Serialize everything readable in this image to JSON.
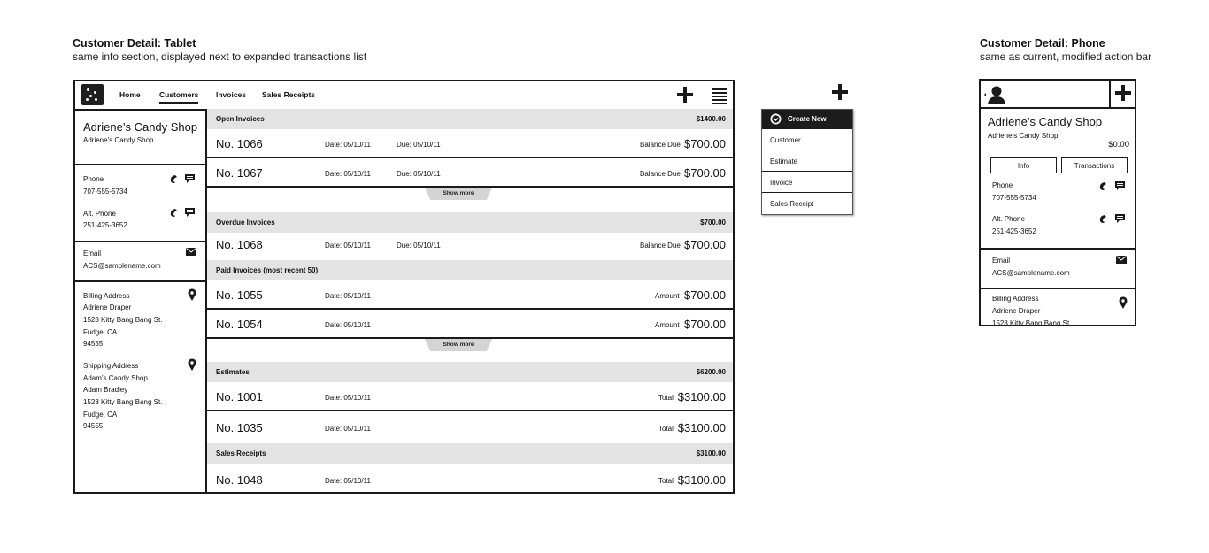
{
  "tablet_caption": {
    "title": "Customer Detail: Tablet",
    "subtitle": "same info section, displayed next to expanded transactions list"
  },
  "phone_caption": {
    "title": "Customer Detail: Phone",
    "subtitle": "same as current, modified action bar"
  },
  "nav": {
    "tabs": [
      "Home",
      "Customers",
      "Invoices",
      "Sales Receipts"
    ],
    "active": "Customers"
  },
  "customer": {
    "name": "Adriene’s Candy Shop",
    "company": "Adriene’s Candy Shop",
    "phone_label": "Phone",
    "phone": "707-555-5734",
    "alt_phone_label": "Alt. Phone",
    "alt_phone": "251-425-3652",
    "email_label": "Email",
    "email": "ACS@samplename.com",
    "billing_label": "Billing Address",
    "billing_lines": [
      "Adriene Draper",
      "1528 Kitty Bang Bang St.",
      "Fudge, CA",
      "94555"
    ],
    "shipping_label": "Shipping Address",
    "shipping_lines": [
      "Adam’s Candy Shop",
      "Adam Bradley",
      "1528 Kitty Bang Bang St.",
      "Fudge, CA",
      "94555"
    ]
  },
  "sections": {
    "open": {
      "label": "Open Invoices",
      "total": "$1400.00"
    },
    "overdue": {
      "label": "Overdue Invoices",
      "total": "$700.00"
    },
    "paid": {
      "label": "Paid Invoices (most recent 50)"
    },
    "estimates": {
      "label": "Estimates",
      "total": "$6200.00"
    },
    "receipts": {
      "label": "Sales Receipts",
      "total": "$3100.00"
    }
  },
  "rows": {
    "r1066": {
      "no": "No. 1066",
      "date": "Date: 05/10/11",
      "due": "Due: 05/10/11",
      "amount_label": "Balance Due",
      "amount": "$700.00"
    },
    "r1067": {
      "no": "No. 1067",
      "date": "Date: 05/10/11",
      "due": "Due: 05/10/11",
      "amount_label": "Balance Due",
      "amount": "$700.00"
    },
    "r1068": {
      "no": "No. 1068",
      "date": "Date: 05/10/11",
      "due": "Due: 05/10/11",
      "amount_label": "Balance Due",
      "amount": "$700.00"
    },
    "r1055": {
      "no": "No. 1055",
      "date": "Date: 05/10/11",
      "amount_label": "Amount",
      "amount": "$700.00"
    },
    "r1054": {
      "no": "No. 1054",
      "date": "Date: 05/10/11",
      "amount_label": "Amount",
      "amount": "$700.00"
    },
    "r1001": {
      "no": "No. 1001",
      "date": "Date: 05/10/11",
      "amount_label": "Total",
      "amount": "$3100.00"
    },
    "r1035": {
      "no": "No. 1035",
      "date": "Date: 05/10/11",
      "amount_label": "Total",
      "amount": "$3100.00"
    },
    "r1048": {
      "no": "No. 1048",
      "date": "Date: 05/10/11",
      "amount_label": "Total",
      "amount": "$3100.00"
    }
  },
  "show_more": "Show more",
  "create_menu": {
    "header": "Create New",
    "items": [
      "Customer",
      "Estimate",
      "Invoice",
      "Sales Receipt"
    ]
  },
  "phone": {
    "balance": "$0.00",
    "tabs": [
      "Info",
      "Transactions"
    ]
  },
  "icons": {
    "app_logo": "logo-icon",
    "add": "plus-icon",
    "menu": "hamburger-icon",
    "call": "phone-icon",
    "message": "chat-icon",
    "email": "envelope-icon",
    "address": "map-pin-icon",
    "back_avatar": "user-icon"
  }
}
